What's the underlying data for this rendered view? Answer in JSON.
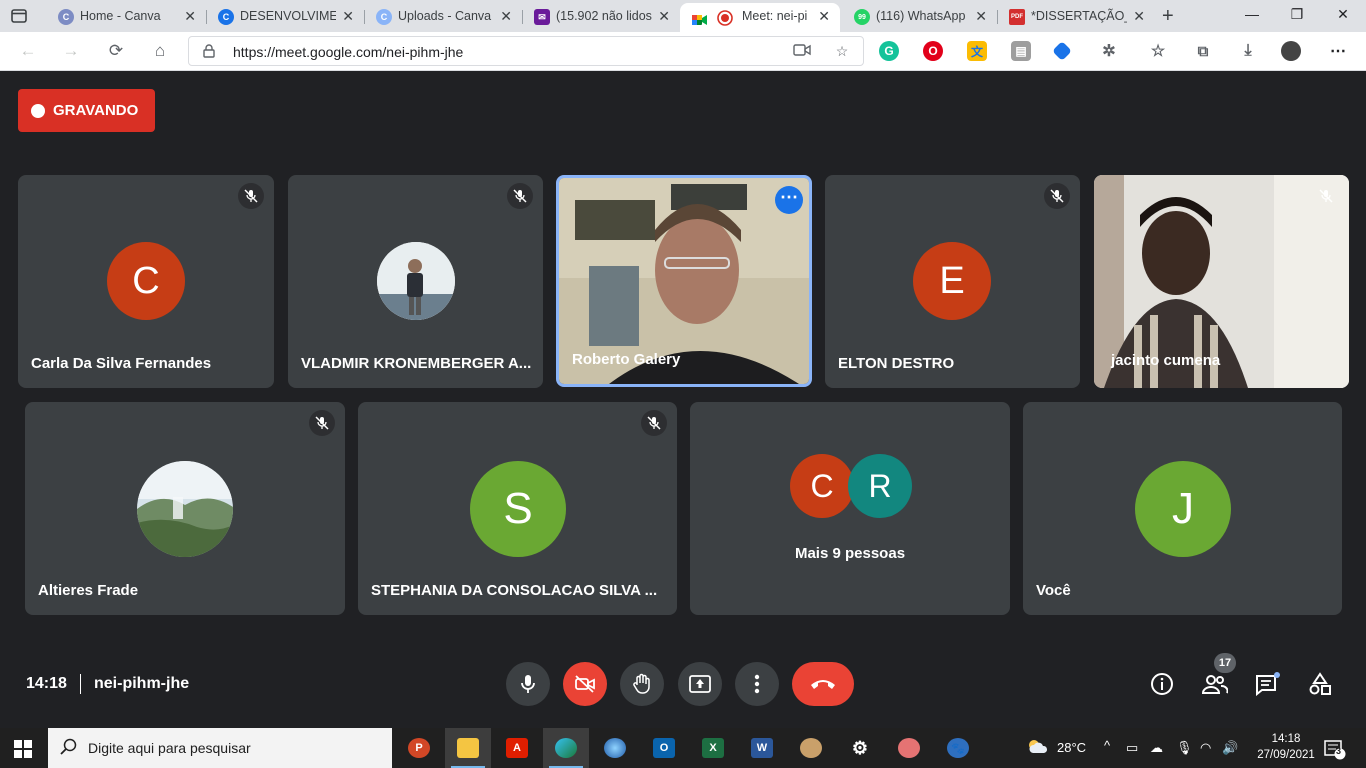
{
  "browser": {
    "tabs": [
      {
        "title": "Home - Canva",
        "favicon_color": "#7d8cc4",
        "favicon_letter": "C"
      },
      {
        "title": "DESENVOLVIMEN",
        "favicon_color": "#1a73e8",
        "favicon_letter": "C"
      },
      {
        "title": "Uploads - Canva",
        "favicon_color": "#8ab4f8",
        "favicon_letter": "C"
      },
      {
        "title": "(15.902 não lidos",
        "favicon_color": "#6a1b9a",
        "favicon_letter": "✉"
      },
      {
        "title": "Meet: nei-pi",
        "favicon_color": "#ffffff",
        "favicon_letter": ""
      },
      {
        "title": "(116) WhatsApp",
        "favicon_color": "#25d366",
        "favicon_letter": "99"
      },
      {
        "title": "*DISSERTAÇÃO_M",
        "favicon_color": "#d32f2f",
        "favicon_letter": "PDF"
      }
    ],
    "url": "https://meet.google.com/nei-pihm-jhe"
  },
  "meet": {
    "recording_label": "GRAVANDO",
    "participants": [
      {
        "name": "Carla Da Silva Fernandes",
        "initial": "C",
        "color": "#c63d15"
      },
      {
        "name": "VLADMIR KRONEMBERGER A...",
        "initial": "",
        "color": ""
      },
      {
        "name": "Roberto Galery",
        "initial": "",
        "color": ""
      },
      {
        "name": "ELTON DESTRO",
        "initial": "E",
        "color": "#c63d15"
      },
      {
        "name": "jacinto cumena",
        "initial": "",
        "color": ""
      },
      {
        "name": "Altieres Frade",
        "initial": "",
        "color": ""
      },
      {
        "name": "STEPHANIA DA CONSOLACAO SILVA ...",
        "initial": "S",
        "color": "#6aa833"
      },
      {
        "name": "Você",
        "initial": "J",
        "color": "#6aa833"
      }
    ],
    "more": {
      "label": "Mais 9 pessoas",
      "avatars": [
        {
          "initial": "C",
          "color": "#c63d15"
        },
        {
          "initial": "R",
          "color": "#12877f"
        }
      ]
    },
    "time": "14:18",
    "meeting_code": "nei-pihm-jhe",
    "participant_count": "17"
  },
  "taskbar": {
    "search_placeholder": "Digite aqui para pesquisar",
    "weather": "28°C",
    "clock_time": "14:18",
    "clock_date": "27/09/2021",
    "notifications": "3"
  }
}
